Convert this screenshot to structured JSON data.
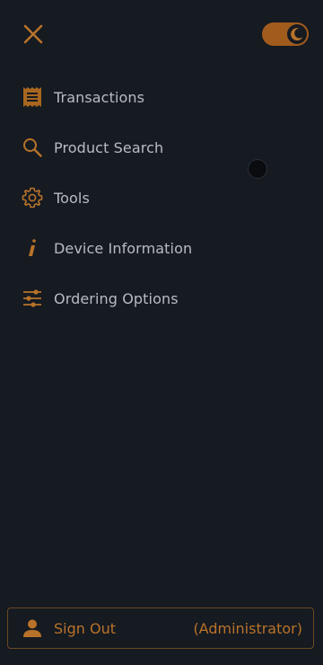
{
  "header": {
    "close_icon": "close-icon",
    "theme_toggle": {
      "state": "dark",
      "icon": "moon-icon"
    }
  },
  "menu": {
    "items": [
      {
        "label": "Transactions",
        "icon": "receipt-icon"
      },
      {
        "label": "Product Search",
        "icon": "search-icon"
      },
      {
        "label": "Tools",
        "icon": "gear-icon"
      },
      {
        "label": "Device Information",
        "icon": "info-icon"
      },
      {
        "label": "Ordering Options",
        "icon": "sliders-icon"
      }
    ]
  },
  "footer": {
    "signout_label": "Sign Out",
    "role": "(Administrator)",
    "icon": "user-icon"
  },
  "colors": {
    "background": "#161a21",
    "accent": "#b8732a",
    "text": "#b8bcc2"
  }
}
